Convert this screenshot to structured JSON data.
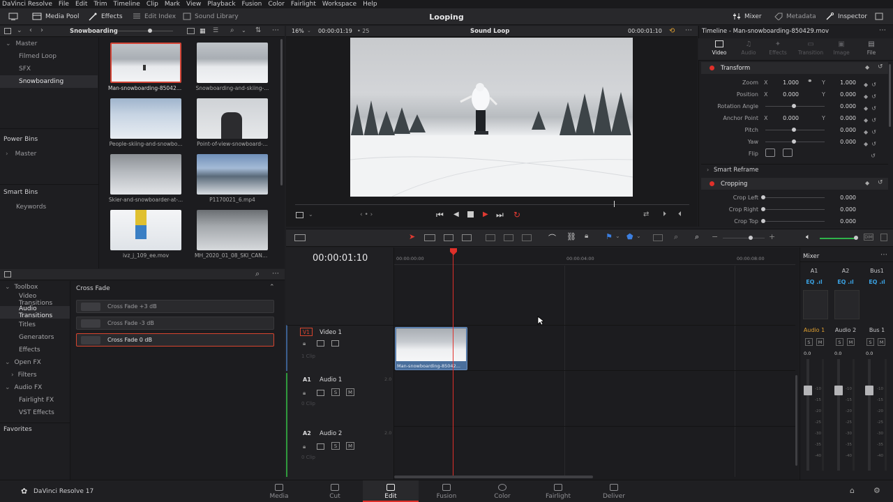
{
  "menu": [
    "DaVinci Resolve",
    "File",
    "Edit",
    "Trim",
    "Timeline",
    "Clip",
    "Mark",
    "View",
    "Playback",
    "Fusion",
    "Color",
    "Fairlight",
    "Workspace",
    "Help"
  ],
  "toolbar": {
    "media_pool": "Media Pool",
    "effects": "Effects",
    "edit_index": "Edit Index",
    "sound_library": "Sound Library",
    "project_title": "Looping",
    "mixer": "Mixer",
    "metadata": "Metadata",
    "inspector": "Inspector"
  },
  "media_pool": {
    "bin_name": "Snowboarding",
    "bins": [
      "Master",
      "Filmed Loop",
      "SFX",
      "Snowboarding"
    ],
    "power_bins_title": "Power Bins",
    "power_bins": [
      "Master"
    ],
    "smart_bins_title": "Smart Bins",
    "smart_bins": [
      "Keywords"
    ],
    "clips": [
      "Man-snowboarding-850429...",
      "Snowboarding-and-skiing-...",
      "People-skiing-and-snowbo...",
      "Point-of-view-snowboard-...",
      "Skier-and-snowboarder-at-...",
      "P1170021_6.mp4",
      "ivz_j_109_ee.mov",
      "MH_2020_01_08_SKI_CANA..."
    ]
  },
  "effects": {
    "tree": [
      "Toolbox",
      "Video Transitions",
      "Audio Transitions",
      "Titles",
      "Generators",
      "Effects",
      "Open FX",
      "Filters",
      "Audio FX",
      "Fairlight FX",
      "VST Effects"
    ],
    "favorites": "Favorites",
    "group_title": "Cross Fade",
    "items": [
      "Cross Fade +3 dB",
      "Cross Fade -3 dB",
      "Cross Fade 0 dB"
    ]
  },
  "viewer": {
    "zoom": "16%",
    "source_tc": "00:00:01:19",
    "fps": "25",
    "clip_name": "Sound Loop",
    "record_tc": "00:00:01:10"
  },
  "timeline": {
    "current_tc": "00:00:01:10",
    "ruler": [
      "00:00:00:00",
      "00:00:04:00",
      "00:00:08:00"
    ],
    "tracks": [
      {
        "id": "V1",
        "name": "Video 1",
        "info": "1 Clip"
      },
      {
        "id": "A1",
        "name": "Audio 1",
        "info": "0 Clip",
        "level": "2.0"
      },
      {
        "id": "A2",
        "name": "Audio 2",
        "info": "0 Clip",
        "level": "2.0"
      }
    ],
    "clip_label": "Man-snowboarding-85042..."
  },
  "inspector": {
    "title": "Timeline - Man-snowboarding-850429.mov",
    "tabs": [
      "Video",
      "Audio",
      "Effects",
      "Transition",
      "Image",
      "File"
    ],
    "transform": "Transform",
    "zoom_label": "Zoom",
    "zoom_x": "1.000",
    "zoom_y": "1.000",
    "position_label": "Position",
    "pos_x": "0.000",
    "pos_y": "0.000",
    "rotation_label": "Rotation Angle",
    "rotation": "0.000",
    "anchor_label": "Anchor Point",
    "anchor_x": "0.000",
    "anchor_y": "0.000",
    "pitch_label": "Pitch",
    "pitch": "0.000",
    "yaw_label": "Yaw",
    "yaw": "0.000",
    "flip_label": "Flip",
    "smart_reframe": "Smart Reframe",
    "cropping": "Cropping",
    "crop_left_label": "Crop Left",
    "crop_left": "0.000",
    "crop_right_label": "Crop Right",
    "crop_right": "0.000",
    "crop_top_label": "Crop Top",
    "crop_top": "0.000",
    "x": "X",
    "y": "Y"
  },
  "mixer": {
    "title": "Mixer",
    "channels": [
      {
        "name": "A1",
        "eq": "EQ",
        "strip": "Audio 1",
        "level": "0.0"
      },
      {
        "name": "A2",
        "eq": "EQ",
        "strip": "Audio 2",
        "level": "0.0"
      },
      {
        "name": "Bus1",
        "eq": "EQ",
        "strip": "Bus 1",
        "level": "0.0"
      }
    ],
    "s": "S",
    "m": "M",
    "scale": [
      "-5",
      "-10",
      "-15",
      "-20",
      "-25",
      "-30",
      "-35",
      "-40",
      "-50"
    ]
  },
  "pages": [
    "Media",
    "Cut",
    "Edit",
    "Fusion",
    "Color",
    "Fairlight",
    "Deliver"
  ],
  "footer": {
    "app": "DaVinci Resolve 17"
  },
  "colors": {
    "accent": "#e0302a",
    "clip_blue": "#4a6f9c",
    "orange": "#e08a2a"
  }
}
